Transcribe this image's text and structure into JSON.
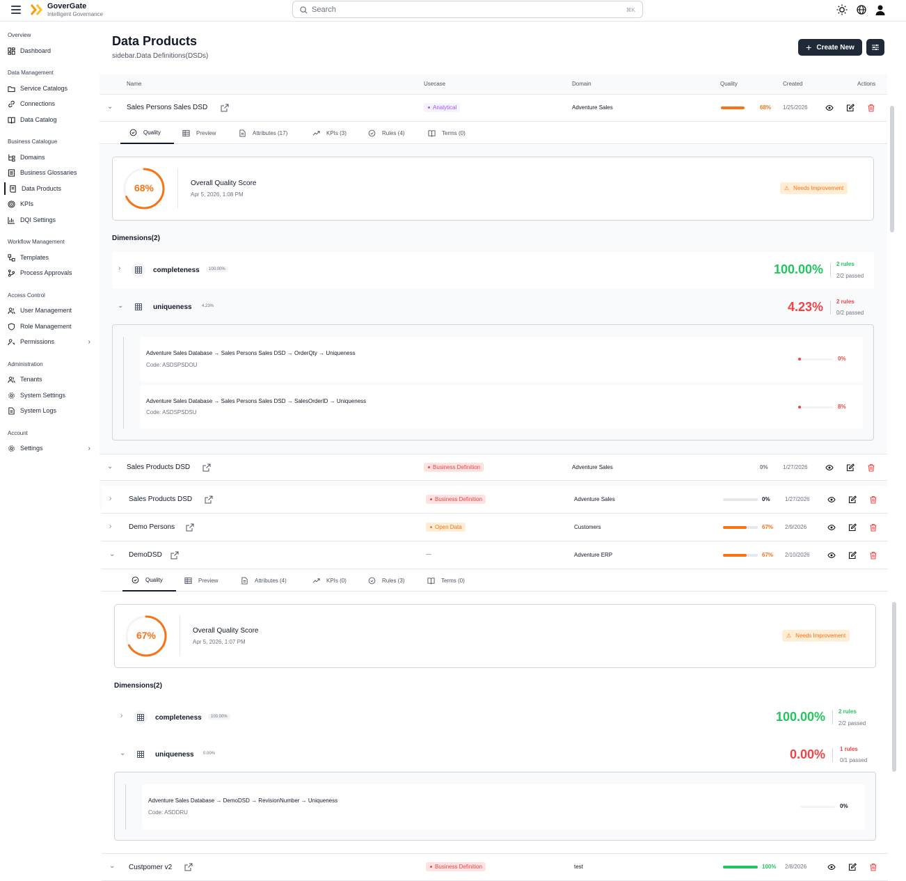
{
  "app": {
    "name": "GoverGate",
    "tagline": "Intelligent Governance"
  },
  "search": {
    "placeholder": "Search",
    "shortcut": "⌘K"
  },
  "sidebar": {
    "sections": [
      {
        "title": "Overview",
        "items": [
          {
            "label": "Dashboard",
            "icon": "dashboard-icon"
          }
        ]
      },
      {
        "title": "Data Management",
        "items": [
          {
            "label": "Service Catalogs"
          },
          {
            "label": "Connections"
          },
          {
            "label": "Data Catalog"
          }
        ]
      },
      {
        "title": "Business Catalogue",
        "items": [
          {
            "label": "Domains"
          },
          {
            "label": "Business Glossaries"
          },
          {
            "label": "Data Products",
            "active": true
          },
          {
            "label": "KPIs"
          },
          {
            "label": "DQI Settings"
          }
        ]
      },
      {
        "title": "Workflow Management",
        "items": [
          {
            "label": "Templates"
          },
          {
            "label": "Process Approvals"
          }
        ]
      },
      {
        "title": "Access Control",
        "items": [
          {
            "label": "User Management"
          },
          {
            "label": "Role Management"
          },
          {
            "label": "Permissions"
          }
        ]
      },
      {
        "title": "Administration",
        "items": [
          {
            "label": "Tenants"
          },
          {
            "label": "System Settings"
          },
          {
            "label": "System Logs"
          }
        ]
      },
      {
        "title": "Account",
        "items": [
          {
            "label": "Settings"
          }
        ]
      }
    ]
  },
  "page": {
    "title": "Data Products",
    "subtitle": "sidebar.Data Definitions(DSDs)",
    "create_label": "Create New"
  },
  "table": {
    "headers": [
      "Name",
      "Usecase",
      "Domain",
      "Quality",
      "Created",
      "Actions"
    ]
  },
  "rows": [
    {
      "name": "Sales Persons Sales DSD",
      "usecase": "Analytical",
      "domain": "Adventure Sales",
      "quality": "68%",
      "created": "1/25/2026"
    },
    {
      "name": "Sales Products DSD",
      "usecase": "Business Definition",
      "domain": "Adventure Sales",
      "quality": "0%",
      "created": "1/27/2026"
    },
    {
      "name": "Sales Products DSD",
      "usecase": "Business Definition",
      "domain": "Adventure Sales",
      "quality": "0%",
      "created": "1/27/2026"
    },
    {
      "name": "Demo Persons",
      "usecase": "Open Data",
      "domain": "Customers",
      "quality": "67%",
      "created": "2/9/2026"
    },
    {
      "name": "DemoDSD",
      "usecase": "—",
      "domain": "Adventure ERP",
      "quality": "67%",
      "created": "2/10/2026"
    },
    {
      "name": "Custpomer v2",
      "usecase": "Business Definition",
      "domain": "test",
      "quality": "100%",
      "created": "2/8/2026"
    }
  ],
  "detail1": {
    "tabs": [
      "Quality",
      "Preview",
      "Attributes (17)",
      "KPIs (3)",
      "Rules (4)",
      "Terms (0)"
    ],
    "score": "68%",
    "score_value": 0.68,
    "score_title": "Overall Quality Score",
    "score_date": "Apr 5, 2026, 1:08 PM",
    "status": "Needs Improvement",
    "dims_title": "Dimensions(2)",
    "dims": [
      {
        "name": "completeness",
        "small": "100.00%",
        "score": "100.00%",
        "rules": "2 rules",
        "passed": "2/2 passed"
      },
      {
        "name": "uniqueness",
        "small": "4.23%",
        "score": "4.23%",
        "rules": "2 rules",
        "passed": "0/2 passed"
      }
    ],
    "rules": [
      {
        "path": "Adventure Sales Database → Sales Persons Sales DSD → OrderQty → Uniqueness",
        "code": "Code: ASDSPSDOU",
        "pct": "0%"
      },
      {
        "path": "Adventure Sales Database → Sales Persons Sales DSD → SalesOrderID → Uniqueness",
        "code": "Code: ASDSPSDSU",
        "pct": "8%"
      }
    ]
  },
  "detail2": {
    "tabs": [
      "Quality",
      "Preview",
      "Attributes (4)",
      "KPIs (0)",
      "Rules (3)",
      "Terms (0)"
    ],
    "score": "67%",
    "score_value": 0.67,
    "score_title": "Overall Quality Score",
    "score_date": "Apr 5, 2026, 1:07 PM",
    "status": "Needs Improvement",
    "dims_title": "Dimensions(2)",
    "dims": [
      {
        "name": "completeness",
        "small": "100.00%",
        "score": "100.00%",
        "rules": "2 rules",
        "passed": "2/2 passed"
      },
      {
        "name": "uniqueness",
        "small": "0.00%",
        "score": "0.00%",
        "rules": "1 rules",
        "passed": "0/1 passed"
      }
    ],
    "rules": [
      {
        "path": "Adventure Sales Database → DemoDSD → RevisionNumber → Uniqueness",
        "code": "Code: ASDDRU",
        "pct": "0%"
      }
    ]
  },
  "colors": {
    "accent": "#f97316",
    "good": "#22c55e",
    "bad": "#ef4444",
    "dark": "#1f2937"
  }
}
